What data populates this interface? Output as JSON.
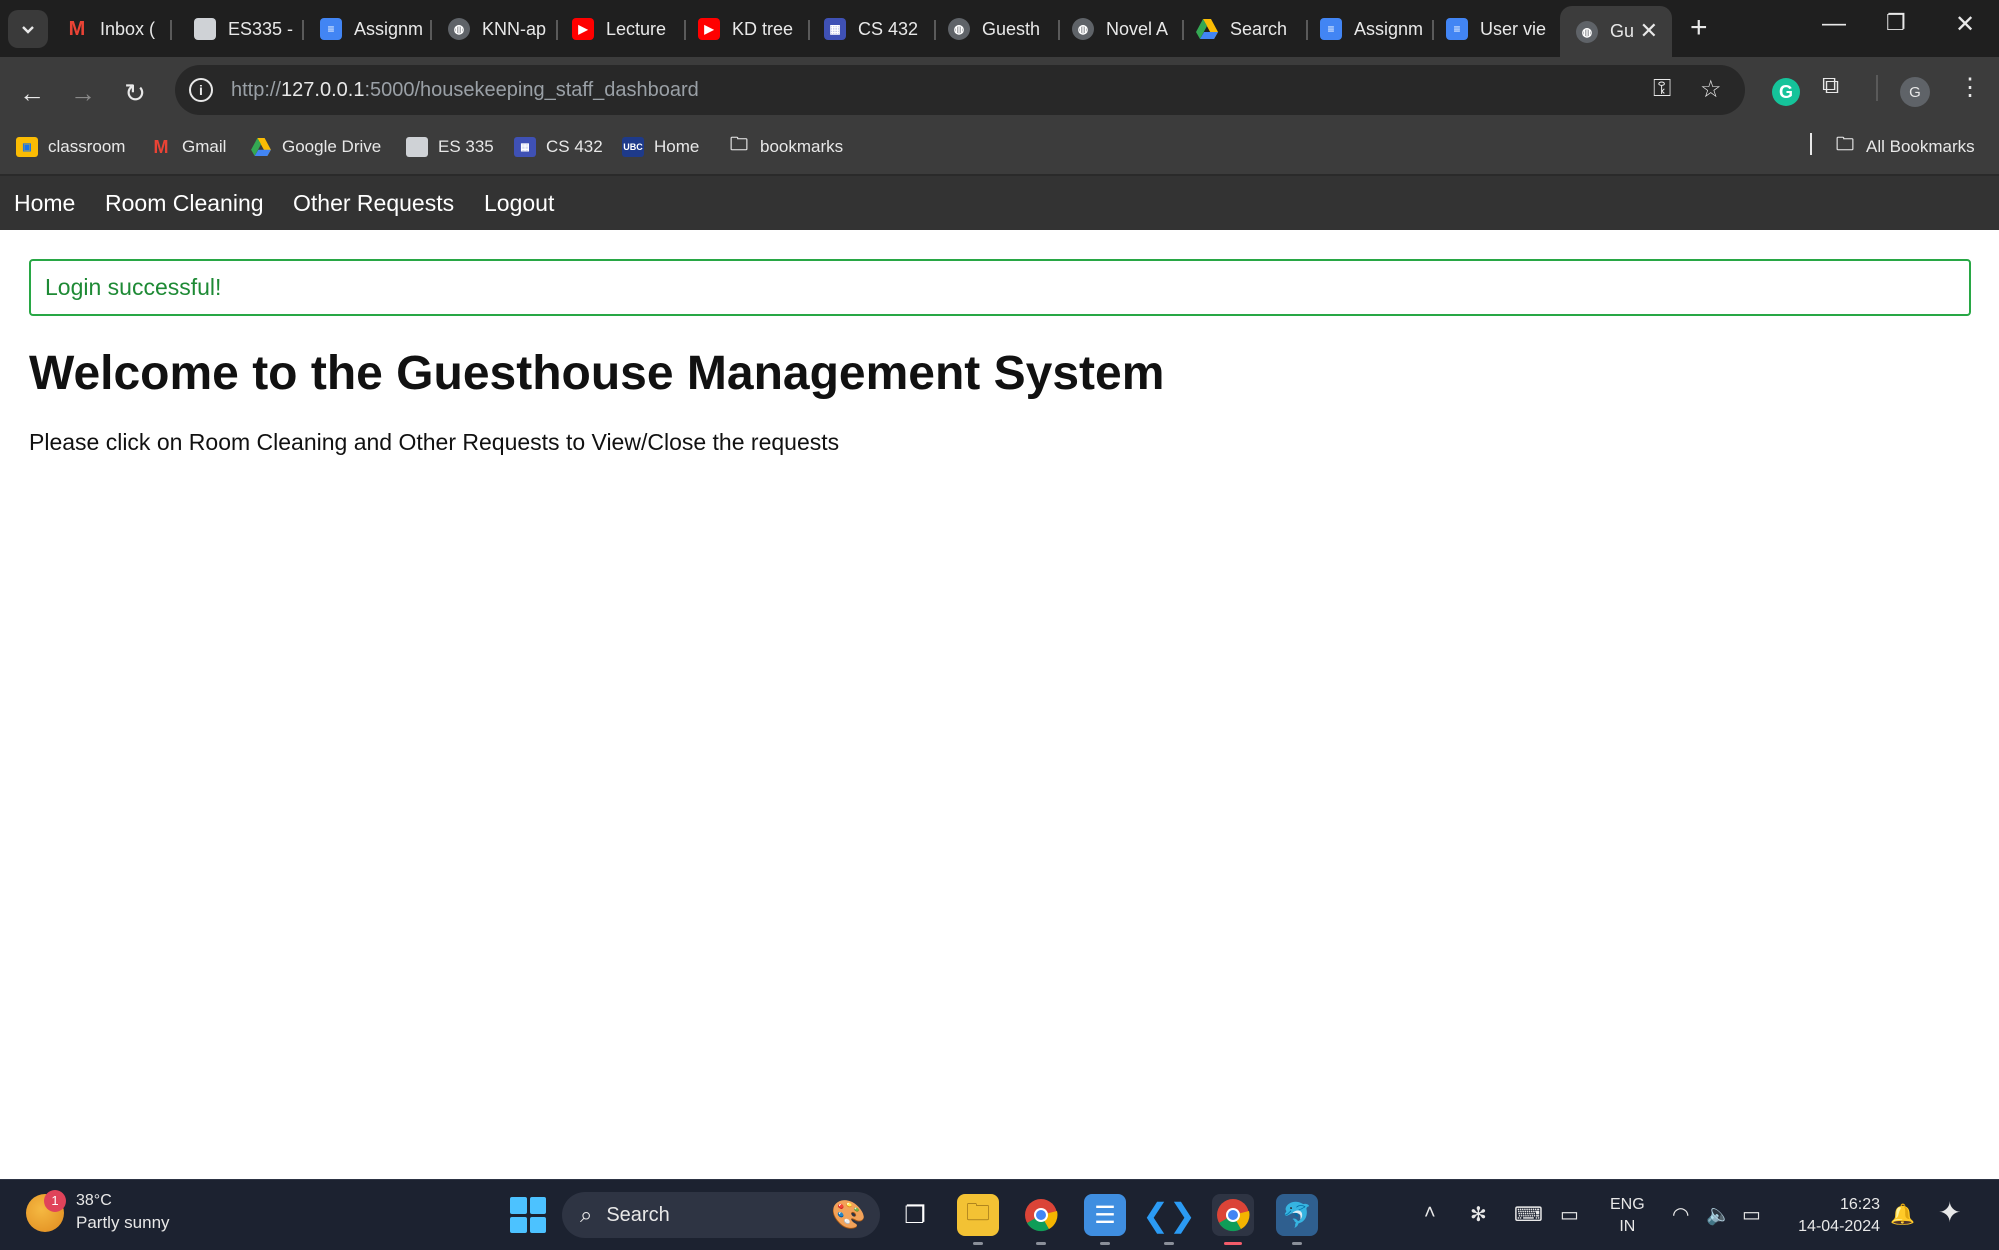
{
  "browser": {
    "tabs": [
      {
        "label": "Inbox (",
        "icon": "gmail-icon",
        "color": "#ea4335"
      },
      {
        "label": "ES335 -",
        "icon": "page-thumbnail-icon",
        "color": "#9aa0a6"
      },
      {
        "label": "Assignm",
        "icon": "google-docs-icon",
        "color": "#4285f4"
      },
      {
        "label": "KNN-ap",
        "icon": "globe-icon",
        "color": "#9aa0a6"
      },
      {
        "label": "Lecture",
        "icon": "youtube-icon",
        "color": "#ff0000"
      },
      {
        "label": "KD tree",
        "icon": "youtube-icon",
        "color": "#ff0000"
      },
      {
        "label": "CS 432",
        "icon": "calendar-site-icon",
        "color": "#3f51b5"
      },
      {
        "label": "Guesth",
        "icon": "globe-icon",
        "color": "#9aa0a6"
      },
      {
        "label": "Novel A",
        "icon": "globe-icon",
        "color": "#9aa0a6"
      },
      {
        "label": "Search",
        "icon": "google-drive-icon",
        "color": "#34a853"
      },
      {
        "label": "Assignm",
        "icon": "google-docs-icon",
        "color": "#4285f4"
      },
      {
        "label": "User vie",
        "icon": "google-docs-icon",
        "color": "#4285f4"
      },
      {
        "label": "Gu",
        "icon": "globe-icon",
        "color": "#9aa0a6",
        "active": true
      }
    ],
    "url_prefix": "http://",
    "url_host": "127.0.0.1",
    "url_rest": ":5000/housekeeping_staff_dashboard",
    "bookmarks": [
      {
        "label": "classroom",
        "icon": "google-classroom-icon"
      },
      {
        "label": "Gmail",
        "icon": "gmail-icon"
      },
      {
        "label": "Google Drive",
        "icon": "google-drive-icon"
      },
      {
        "label": "ES 335",
        "icon": "page-thumbnail-icon"
      },
      {
        "label": "CS 432",
        "icon": "calendar-site-icon"
      },
      {
        "label": "Home",
        "icon": "ubc-icon"
      },
      {
        "label": "bookmarks",
        "icon": "folder-icon"
      }
    ],
    "all_bookmarks": "All Bookmarks",
    "avatar_letter": "G",
    "grammarly_letter": "G"
  },
  "site": {
    "nav": [
      "Home",
      "Room Cleaning",
      "Other Requests",
      "Logout"
    ],
    "alert": "Login successful!",
    "title": "Welcome to the Guesthouse Management System",
    "subtitle": "Please click on Room Cleaning and Other Requests to View/Close the requests",
    "accent_color": "#28a745"
  },
  "taskbar": {
    "weather_badge": "1",
    "weather_temp": "38°C",
    "weather_cond": "Partly sunny",
    "search_placeholder": "Search",
    "lang_line1": "ENG",
    "lang_line2": "IN",
    "time": "16:23",
    "date": "14-04-2024"
  }
}
